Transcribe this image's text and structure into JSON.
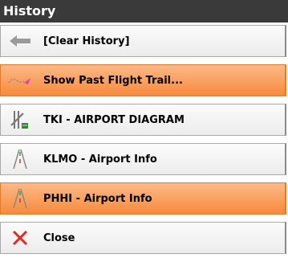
{
  "header": {
    "title": "History"
  },
  "menu": {
    "items": [
      {
        "label": "[Clear History]",
        "icon": "back-arrow-icon",
        "highlighted": false
      },
      {
        "label": "Show Past Flight Trail...",
        "icon": "flight-trail-icon",
        "highlighted": true
      },
      {
        "label": "TKI - AIRPORT DIAGRAM",
        "icon": "airport-diagram-icon",
        "highlighted": false
      },
      {
        "label": "KLMO - Airport Info",
        "icon": "runway-icon",
        "highlighted": false
      },
      {
        "label": "PHHI - Airport Info",
        "icon": "runway-icon",
        "highlighted": true
      },
      {
        "label": "Close",
        "icon": "close-icon",
        "highlighted": false
      }
    ]
  },
  "colors": {
    "title_bg": "#3a3a3a",
    "highlight": "#f68a3c",
    "close_x": "#e8281e"
  }
}
